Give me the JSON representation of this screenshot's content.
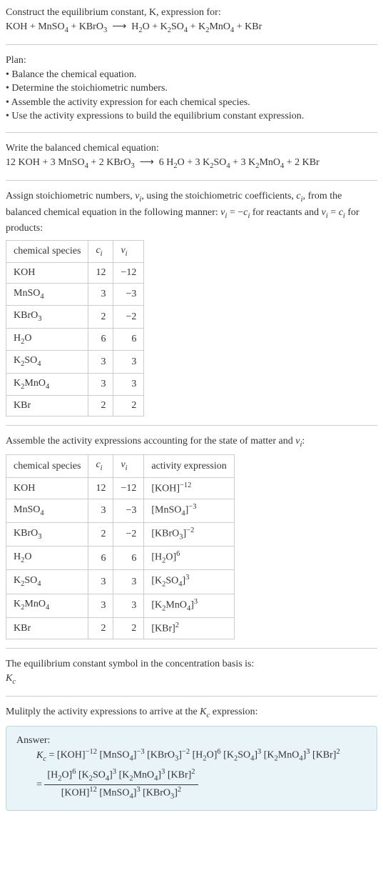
{
  "intro": {
    "line1": "Construct the equilibrium constant, K, expression for:",
    "equation": "KOH + MnSO₄ + KBrO₃ ⟶ H₂O + K₂SO₄ + K₂MnO₄ + KBr"
  },
  "plan": {
    "title": "Plan:",
    "items": [
      "• Balance the chemical equation.",
      "• Determine the stoichiometric numbers.",
      "• Assemble the activity expression for each chemical species.",
      "• Use the activity expressions to build the equilibrium constant expression."
    ]
  },
  "balanced": {
    "title": "Write the balanced chemical equation:",
    "equation": "12 KOH + 3 MnSO₄ + 2 KBrO₃ ⟶ 6 H₂O + 3 K₂SO₄ + 3 K₂MnO₄ + 2 KBr"
  },
  "assign": {
    "text": "Assign stoichiometric numbers, νᵢ, using the stoichiometric coefficients, cᵢ, from the balanced chemical equation in the following manner: νᵢ = −cᵢ for reactants and νᵢ = cᵢ for products:"
  },
  "table1": {
    "headers": [
      "chemical species",
      "cᵢ",
      "νᵢ"
    ],
    "rows": [
      {
        "species": "KOH",
        "c": "12",
        "v": "−12"
      },
      {
        "species": "MnSO₄",
        "c": "3",
        "v": "−3"
      },
      {
        "species": "KBrO₃",
        "c": "2",
        "v": "−2"
      },
      {
        "species": "H₂O",
        "c": "6",
        "v": "6"
      },
      {
        "species": "K₂SO₄",
        "c": "3",
        "v": "3"
      },
      {
        "species": "K₂MnO₄",
        "c": "3",
        "v": "3"
      },
      {
        "species": "KBr",
        "c": "2",
        "v": "2"
      }
    ]
  },
  "assemble": {
    "text": "Assemble the activity expressions accounting for the state of matter and νᵢ:"
  },
  "table2": {
    "headers": [
      "chemical species",
      "cᵢ",
      "νᵢ",
      "activity expression"
    ],
    "rows": [
      {
        "species": "KOH",
        "c": "12",
        "v": "−12",
        "expr_base": "[KOH]",
        "expr_exp": "−12"
      },
      {
        "species": "MnSO₄",
        "c": "3",
        "v": "−3",
        "expr_base": "[MnSO₄]",
        "expr_exp": "−3"
      },
      {
        "species": "KBrO₃",
        "c": "2",
        "v": "−2",
        "expr_base": "[KBrO₃]",
        "expr_exp": "−2"
      },
      {
        "species": "H₂O",
        "c": "6",
        "v": "6",
        "expr_base": "[H₂O]",
        "expr_exp": "6"
      },
      {
        "species": "K₂SO₄",
        "c": "3",
        "v": "3",
        "expr_base": "[K₂SO₄]",
        "expr_exp": "3"
      },
      {
        "species": "K₂MnO₄",
        "c": "3",
        "v": "3",
        "expr_base": "[K₂MnO₄]",
        "expr_exp": "3"
      },
      {
        "species": "KBr",
        "c": "2",
        "v": "2",
        "expr_base": "[KBr]",
        "expr_exp": "2"
      }
    ]
  },
  "symbol": {
    "line1": "The equilibrium constant symbol in the concentration basis is:",
    "line2": "K_c"
  },
  "multiply": {
    "text": "Mulitply the activity expressions to arrive at the K_c expression:"
  },
  "answer": {
    "label": "Answer:",
    "kc": "K_c",
    "eq1": {
      "parts": [
        {
          "base": "[KOH]",
          "exp": "−12"
        },
        {
          "base": "[MnSO₄]",
          "exp": "−3"
        },
        {
          "base": "[KBrO₃]",
          "exp": "−2"
        },
        {
          "base": "[H₂O]",
          "exp": "6"
        },
        {
          "base": "[K₂SO₄]",
          "exp": "3"
        },
        {
          "base": "[K₂MnO₄]",
          "exp": "3"
        },
        {
          "base": "[KBr]",
          "exp": "2"
        }
      ]
    },
    "eq2": {
      "num": [
        {
          "base": "[H₂O]",
          "exp": "6"
        },
        {
          "base": "[K₂SO₄]",
          "exp": "3"
        },
        {
          "base": "[K₂MnO₄]",
          "exp": "3"
        },
        {
          "base": "[KBr]",
          "exp": "2"
        }
      ],
      "den": [
        {
          "base": "[KOH]",
          "exp": "12"
        },
        {
          "base": "[MnSO₄]",
          "exp": "3"
        },
        {
          "base": "[KBrO₃]",
          "exp": "2"
        }
      ]
    }
  }
}
